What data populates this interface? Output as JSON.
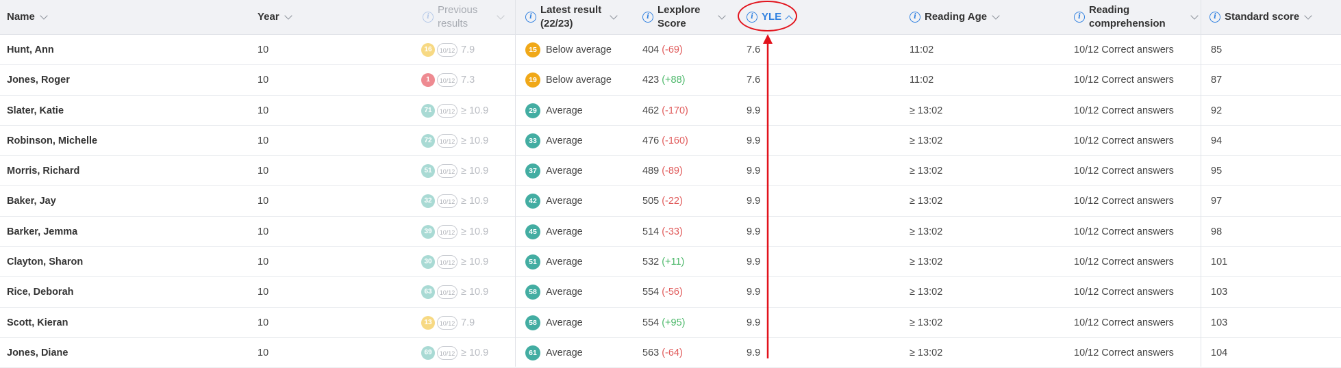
{
  "columns": [
    {
      "label": "Name",
      "icon": "",
      "sort": "chevron-down"
    },
    {
      "label": "Year",
      "icon": "",
      "sort": "chevron-down"
    },
    {
      "label_line1": "Previous",
      "label_line2": "results",
      "icon": "info-icon",
      "sort": "chevron-down",
      "state": "disabled"
    },
    {
      "label_line1": "Latest result",
      "label_line2": "(22/23)",
      "icon": "info-icon",
      "sort": "chevron-down"
    },
    {
      "label_line1": "Lexplore",
      "label_line2": "Score",
      "icon": "info-icon",
      "sort": "chevron-down"
    },
    {
      "label": "YLE",
      "icon": "info-icon",
      "sort": "chevron-up"
    },
    {
      "label": "Reading Age",
      "icon": "info-icon",
      "sort": "chevron-down"
    },
    {
      "label_line1": "Reading",
      "label_line2": "comprehension",
      "icon": "info-icon",
      "sort": "chevron-down"
    },
    {
      "label": "Standard score",
      "icon": "info-icon",
      "sort": "chevron-down"
    }
  ],
  "colors": {
    "below_average": "#f0a818",
    "average": "#43ada2",
    "prev_yellow": "#f7d983",
    "prev_red": "#ee8a91",
    "prev_teal": "#a9dad4",
    "negative": "#e05a5a",
    "positive": "#4cb86a",
    "annotation": "#e2131c"
  },
  "rows": [
    {
      "name": "Hunt, Ann",
      "year": "10",
      "prev_badge": "16",
      "prev_badge_color": "prev_yellow",
      "prev_out": "10/12",
      "prev_value": "7.9",
      "latest_badge": "15",
      "latest_color": "below_average",
      "latest_label": "Below average",
      "lex": "404",
      "lex_delta": "(-69)",
      "lex_sign": "neg",
      "yle": "7.6",
      "reading_age": "11:02",
      "comprehension": "10/12 Correct answers",
      "standard": "85"
    },
    {
      "name": "Jones, Roger",
      "year": "10",
      "prev_badge": "1",
      "prev_badge_color": "prev_red",
      "prev_out": "10/12",
      "prev_value": "7.3",
      "latest_badge": "19",
      "latest_color": "below_average",
      "latest_label": "Below average",
      "lex": "423",
      "lex_delta": "(+88)",
      "lex_sign": "pos",
      "yle": "7.6",
      "reading_age": "11:02",
      "comprehension": "10/12 Correct answers",
      "standard": "87"
    },
    {
      "name": "Slater, Katie",
      "year": "10",
      "prev_badge": "71",
      "prev_badge_color": "prev_teal",
      "prev_out": "10/12",
      "prev_value": "≥ 10.9",
      "latest_badge": "29",
      "latest_color": "average",
      "latest_label": "Average",
      "lex": "462",
      "lex_delta": "(-170)",
      "lex_sign": "neg",
      "yle": "9.9",
      "reading_age": "≥ 13:02",
      "comprehension": "10/12 Correct answers",
      "standard": "92"
    },
    {
      "name": "Robinson, Michelle",
      "year": "10",
      "prev_badge": "72",
      "prev_badge_color": "prev_teal",
      "prev_out": "10/12",
      "prev_value": "≥ 10.9",
      "latest_badge": "33",
      "latest_color": "average",
      "latest_label": "Average",
      "lex": "476",
      "lex_delta": "(-160)",
      "lex_sign": "neg",
      "yle": "9.9",
      "reading_age": "≥ 13:02",
      "comprehension": "10/12 Correct answers",
      "standard": "94"
    },
    {
      "name": "Morris, Richard",
      "year": "10",
      "prev_badge": "51",
      "prev_badge_color": "prev_teal",
      "prev_out": "10/12",
      "prev_value": "≥ 10.9",
      "latest_badge": "37",
      "latest_color": "average",
      "latest_label": "Average",
      "lex": "489",
      "lex_delta": "(-89)",
      "lex_sign": "neg",
      "yle": "9.9",
      "reading_age": "≥ 13:02",
      "comprehension": "10/12 Correct answers",
      "standard": "95"
    },
    {
      "name": "Baker, Jay",
      "year": "10",
      "prev_badge": "32",
      "prev_badge_color": "prev_teal",
      "prev_out": "10/12",
      "prev_value": "≥ 10.9",
      "latest_badge": "42",
      "latest_color": "average",
      "latest_label": "Average",
      "lex": "505",
      "lex_delta": "(-22)",
      "lex_sign": "neg",
      "yle": "9.9",
      "reading_age": "≥ 13:02",
      "comprehension": "10/12 Correct answers",
      "standard": "97"
    },
    {
      "name": "Barker, Jemma",
      "year": "10",
      "prev_badge": "39",
      "prev_badge_color": "prev_teal",
      "prev_out": "10/12",
      "prev_value": "≥ 10.9",
      "latest_badge": "45",
      "latest_color": "average",
      "latest_label": "Average",
      "lex": "514",
      "lex_delta": "(-33)",
      "lex_sign": "neg",
      "yle": "9.9",
      "reading_age": "≥ 13:02",
      "comprehension": "10/12 Correct answers",
      "standard": "98"
    },
    {
      "name": "Clayton, Sharon",
      "year": "10",
      "prev_badge": "30",
      "prev_badge_color": "prev_teal",
      "prev_out": "10/12",
      "prev_value": "≥ 10.9",
      "latest_badge": "51",
      "latest_color": "average",
      "latest_label": "Average",
      "lex": "532",
      "lex_delta": "(+11)",
      "lex_sign": "pos",
      "yle": "9.9",
      "reading_age": "≥ 13:02",
      "comprehension": "10/12 Correct answers",
      "standard": "101"
    },
    {
      "name": "Rice, Deborah",
      "year": "10",
      "prev_badge": "63",
      "prev_badge_color": "prev_teal",
      "prev_out": "10/12",
      "prev_value": "≥ 10.9",
      "latest_badge": "58",
      "latest_color": "average",
      "latest_label": "Average",
      "lex": "554",
      "lex_delta": "(-56)",
      "lex_sign": "neg",
      "yle": "9.9",
      "reading_age": "≥ 13:02",
      "comprehension": "10/12 Correct answers",
      "standard": "103"
    },
    {
      "name": "Scott, Kieran",
      "year": "10",
      "prev_badge": "13",
      "prev_badge_color": "prev_yellow",
      "prev_out": "10/12",
      "prev_value": "7.9",
      "latest_badge": "58",
      "latest_color": "average",
      "latest_label": "Average",
      "lex": "554",
      "lex_delta": "(+95)",
      "lex_sign": "pos",
      "yle": "9.9",
      "reading_age": "≥ 13:02",
      "comprehension": "10/12 Correct answers",
      "standard": "103"
    },
    {
      "name": "Jones, Diane",
      "year": "10",
      "prev_badge": "69",
      "prev_badge_color": "prev_teal",
      "prev_out": "10/12",
      "prev_value": "≥ 10.9",
      "latest_badge": "61",
      "latest_color": "average",
      "latest_label": "Average",
      "lex": "563",
      "lex_delta": "(-64)",
      "lex_sign": "neg",
      "yle": "9.9",
      "reading_age": "≥ 13:02",
      "comprehension": "10/12 Correct answers",
      "standard": "104"
    }
  ]
}
